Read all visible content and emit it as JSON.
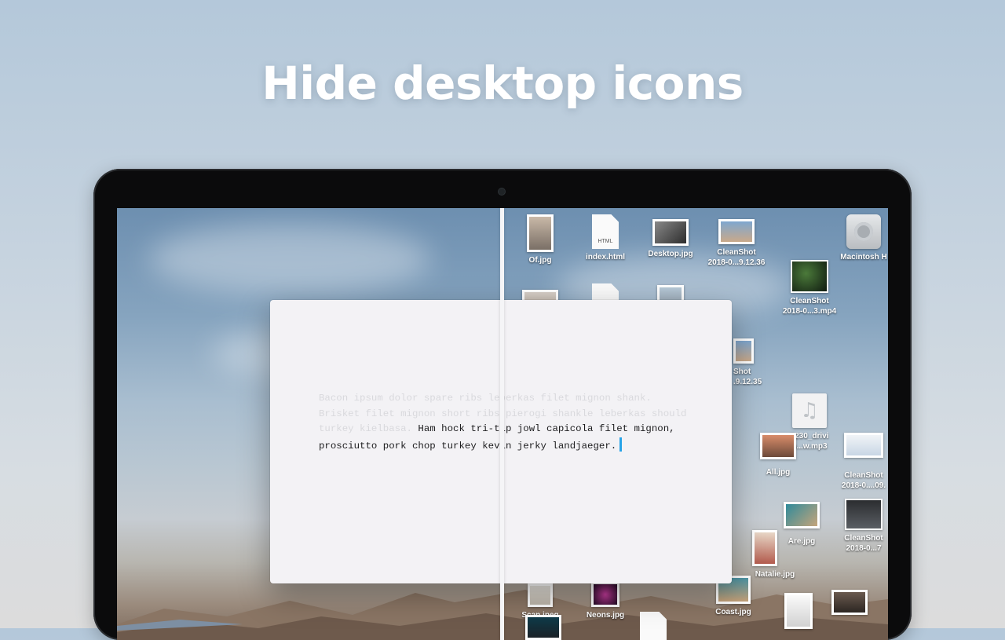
{
  "headline": "Hide desktop icons",
  "editor": {
    "faded_text": "Bacon ipsum dolor spare ribs leberkas filet mignon shank. Brisket filet mignon short ribs pierogi shankle leberkas should turkey kielbasa.",
    "active_text_line1": "Ham hock tri-tip jowl capicola filet mignon,",
    "active_text_line2": "prosciutto pork chop turkey kevin jerky landjaeger."
  },
  "desktop_icons": [
    {
      "label": "Of.jpg",
      "icon": "image-file-icon"
    },
    {
      "label": "index.html",
      "icon": "html-file-icon",
      "badge": "HTML"
    },
    {
      "label": "Desktop.jpg",
      "icon": "image-file-icon"
    },
    {
      "label": "CleanShot\n2018-0...9.12.36",
      "icon": "image-file-icon"
    },
    {
      "label": "Macintosh H",
      "icon": "hard-drive-icon"
    },
    {
      "label": "CleanShot\n2018-0...3.mp4",
      "icon": "video-file-icon"
    },
    {
      "label": "Shot\n.9.12.35",
      "icon": "image-file-icon"
    },
    {
      "label": "7230_drivi\nb...w.mp3",
      "icon": "audio-file-icon",
      "glyph": "♫"
    },
    {
      "label": "All.jpg",
      "icon": "image-file-icon"
    },
    {
      "label": "CleanShot\n2018-0....09.",
      "icon": "image-file-icon"
    },
    {
      "label": "Are.jpg",
      "icon": "image-file-icon"
    },
    {
      "label": "CleanShot\n2018-0...7",
      "icon": "image-file-icon"
    },
    {
      "label": "Natalie.jpg",
      "icon": "image-file-icon"
    },
    {
      "label": "Scan.jpeg",
      "icon": "image-file-icon"
    },
    {
      "label": "Neons.jpg",
      "icon": "image-file-icon"
    },
    {
      "label": "Coast.jpg",
      "icon": "image-file-icon"
    }
  ],
  "colors": {
    "cursor": "#27a3e8",
    "window_bg": "#f3f2f5",
    "bezel": "#0b0b0c"
  }
}
